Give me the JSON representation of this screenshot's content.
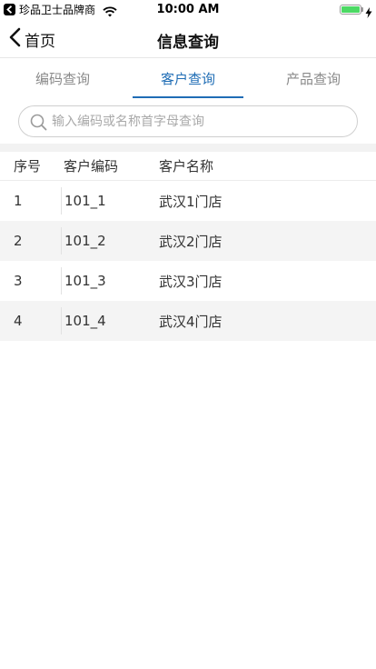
{
  "status_bar": {
    "app_name": "珍品卫士品牌商",
    "time": "10:00 AM",
    "battery_level": 1.0
  },
  "nav": {
    "back_label": "首页",
    "title": "信息查询"
  },
  "tabs": [
    {
      "label": "编码查询",
      "active": false
    },
    {
      "label": "客户查询",
      "active": true
    },
    {
      "label": "产品查询",
      "active": false
    }
  ],
  "search": {
    "placeholder": "输入编码或名称首字母查询",
    "value": ""
  },
  "table": {
    "headers": [
      "序号",
      "客户编码",
      "客户名称"
    ],
    "rows": [
      [
        "1",
        "101_1",
        "武汉1门店"
      ],
      [
        "2",
        "101_2",
        "武汉2门店"
      ],
      [
        "3",
        "101_3",
        "武汉3门店"
      ],
      [
        "4",
        "101_4",
        "武汉4门店"
      ]
    ]
  },
  "colors": {
    "accent": "#1f6db5",
    "battery": "#4cd964"
  }
}
